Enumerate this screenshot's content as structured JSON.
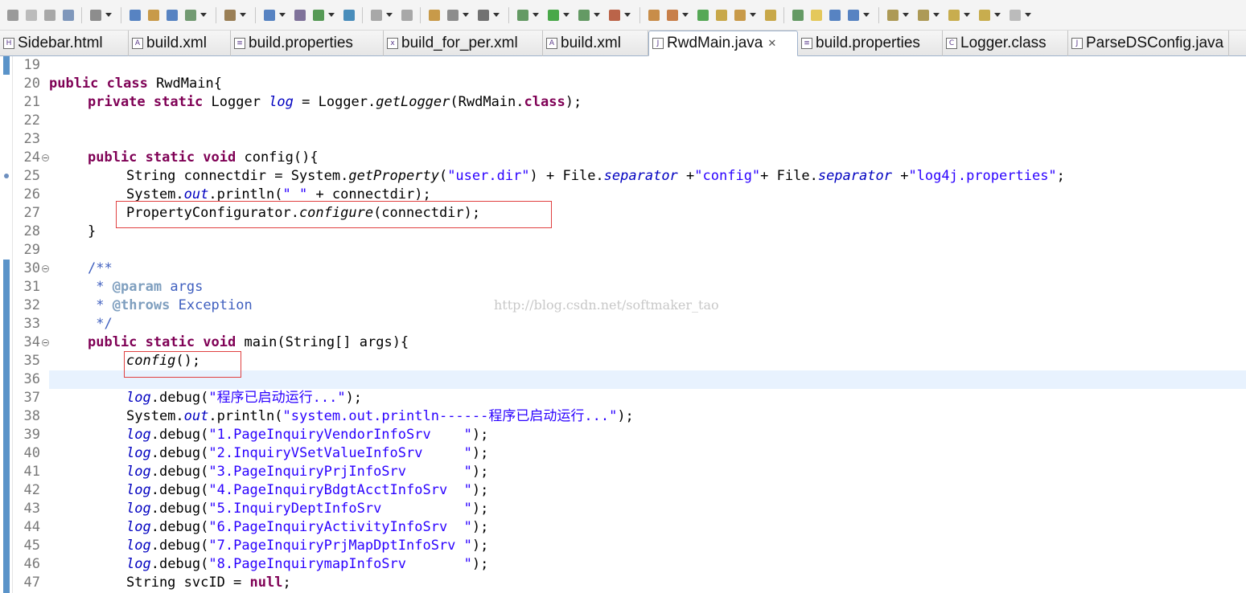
{
  "toolbar": {
    "icons": [
      "new-icon",
      "save-icon",
      "save-all-icon",
      "print-icon",
      "build-icon",
      "package-explorer-icon",
      "open-type-icon",
      "open-type2-icon",
      "search-icon",
      "refactor-icon",
      "search-java-icon",
      "run-ant-icon",
      "deploy-icon",
      "globe-icon",
      "undo-icon",
      "redo-icon",
      "new-class-icon",
      "ext-tool-icon",
      "camera-icon",
      "debug-icon",
      "run-icon",
      "coverage-icon",
      "profile-icon",
      "new-java-project-icon",
      "new-package-icon",
      "new-class2-icon",
      "open-folder-icon",
      "pen-icon",
      "open-folder2-icon",
      "annotation-icon",
      "highlight-icon",
      "block-select-icon",
      "whitespace-icon",
      "next-annotation-icon",
      "prev-annotation-icon",
      "last-edit-icon",
      "back-icon",
      "forward-icon"
    ]
  },
  "tabs": [
    {
      "label": "Sidebar.html",
      "icon": "html-file-icon"
    },
    {
      "label": "build.xml",
      "icon": "ant-file-icon"
    },
    {
      "label": "build.properties",
      "icon": "properties-file-icon"
    },
    {
      "label": "build_for_per.xml",
      "icon": "xml-file-icon"
    },
    {
      "label": "build.xml",
      "icon": "ant-file-icon"
    },
    {
      "label": "RwdMain.java",
      "icon": "java-file-icon",
      "active": true
    },
    {
      "label": "build.properties",
      "icon": "properties-file-icon"
    },
    {
      "label": "Logger.class",
      "icon": "class-file-icon"
    },
    {
      "label": "ParseDSConfig.java",
      "icon": "java-file-icon"
    }
  ],
  "editor": {
    "line_numbers": [
      "19",
      "20",
      "21",
      "22",
      "23",
      "24",
      "25",
      "26",
      "27",
      "28",
      "29",
      "30",
      "31",
      "32",
      "33",
      "34",
      "35",
      "36",
      "37",
      "38",
      "39",
      "40",
      "41",
      "42",
      "43",
      "44",
      "45",
      "46",
      "47"
    ],
    "code": {
      "l20a": "public class",
      "l20b": " RwdMain{",
      "l21a": "private static",
      "l21b": " Logger ",
      "l21c": "log",
      "l21d": " = Logger.",
      "l21e": "getLogger",
      "l21f": "(RwdMain.",
      "l21g": "class",
      "l21h": ");",
      "l24a": "public static void",
      "l24b": " config(){",
      "l25a": "String connectdir = System.",
      "l25b": "getProperty",
      "l25c": "(",
      "l25d": "\"user.dir\"",
      "l25e": ") + File.",
      "l25f": "separator",
      "l25g": " +",
      "l25h": "\"config\"",
      "l25i": "+ File.",
      "l25j": "separator",
      "l25k": " +",
      "l25l": "\"log4j.properties\"",
      "l25m": ";",
      "l26a": "System.",
      "l26b": "out",
      "l26c": ".println(",
      "l26d": "\" \"",
      "l26e": " + connectdir);",
      "l27a": "PropertyConfigurator.",
      "l27b": "configure",
      "l27c": "(connectdir);",
      "l28": "}",
      "l30": "/**",
      "l31a": " * ",
      "l31b": "@param",
      "l31c": " args",
      "l32a": " * ",
      "l32b": "@throws",
      "l32c": " Exception",
      "l33": " */",
      "l34a": "public static void",
      "l34b": " main(String[] args){",
      "l35a": "config",
      "l35b": "();",
      "l37a": "log",
      "l37b": ".debug(",
      "l37c": "\"程序已启动运行...\"",
      "l37d": ");",
      "l38a": "System.",
      "l38b": "out",
      "l38c": ".println(",
      "l38d": "\"system.out.println------程序已启动运行...\"",
      "l38e": ");",
      "debug_lines": [
        "\"1.PageInquiryVendorInfoSrv    \"",
        "\"2.InquiryVSetValueInfoSrv     \"",
        "\"3.PageInquiryPrjInfoSrv       \"",
        "\"4.PageInquiryBdgtAcctInfoSrv  \"",
        "\"5.InquiryDeptInfoSrv          \"",
        "\"6.PageInquiryActivityInfoSrv  \"",
        "\"7.PageInquiryPrjMapDptInfoSrv \"",
        "\"8.PageInquirymapInfoSrv       \""
      ],
      "log_word": "log",
      "debug_word": ".debug(",
      "close": ");",
      "l47a": "String svcID = ",
      "l47b": "null",
      "l47c": ";"
    },
    "watermark": "http://blog.csdn.net/softmaker_tao"
  }
}
